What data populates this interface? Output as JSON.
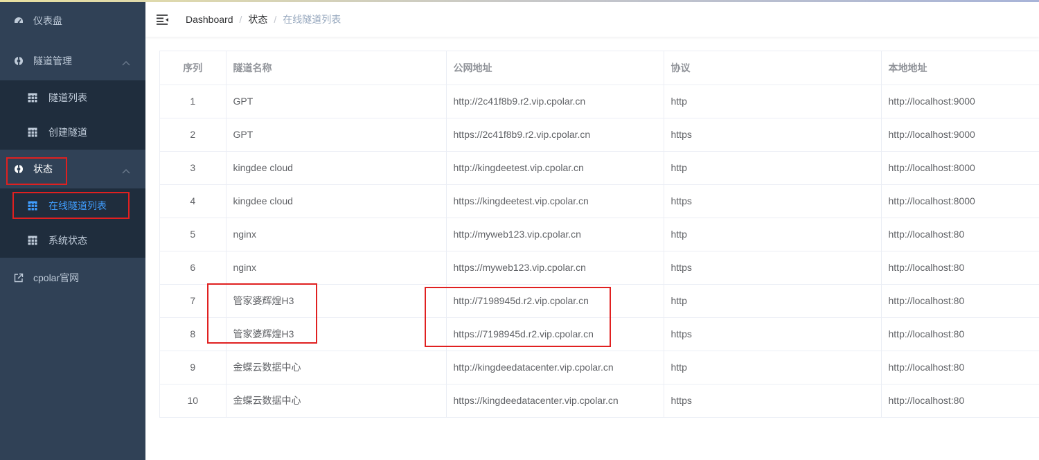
{
  "sidebar": {
    "dashboard": "仪表盘",
    "tunnel_mgmt": "隧道管理",
    "tunnel_list": "隧道列表",
    "create_tunnel": "创建隧道",
    "status": "状态",
    "online_tunnels": "在线隧道列表",
    "system_status": "系统状态",
    "website": "cpolar官网"
  },
  "breadcrumb": [
    "Dashboard",
    "状态",
    "在线隧道列表"
  ],
  "breadcrumb_sep": "/",
  "table": {
    "headers": [
      "序列",
      "隧道名称",
      "公网地址",
      "协议",
      "本地地址"
    ],
    "rows": [
      [
        "1",
        "GPT",
        "http://2c41f8b9.r2.vip.cpolar.cn",
        "http",
        "http://localhost:9000"
      ],
      [
        "2",
        "GPT",
        "https://2c41f8b9.r2.vip.cpolar.cn",
        "https",
        "http://localhost:9000"
      ],
      [
        "3",
        "kingdee cloud",
        "http://kingdeetest.vip.cpolar.cn",
        "http",
        "http://localhost:8000"
      ],
      [
        "4",
        "kingdee cloud",
        "https://kingdeetest.vip.cpolar.cn",
        "https",
        "http://localhost:8000"
      ],
      [
        "5",
        "nginx",
        "http://myweb123.vip.cpolar.cn",
        "http",
        "http://localhost:80"
      ],
      [
        "6",
        "nginx",
        "https://myweb123.vip.cpolar.cn",
        "https",
        "http://localhost:80"
      ],
      [
        "7",
        "管家婆辉煌H3",
        "http://7198945d.r2.vip.cpolar.cn",
        "http",
        "http://localhost:80"
      ],
      [
        "8",
        "管家婆辉煌H3",
        "https://7198945d.r2.vip.cpolar.cn",
        "https",
        "http://localhost:80"
      ],
      [
        "9",
        "金蝶云数据中心",
        "http://kingdeedatacenter.vip.cpolar.cn",
        "http",
        "http://localhost:80"
      ],
      [
        "10",
        "金蝶云数据中心",
        "https://kingdeedatacenter.vip.cpolar.cn",
        "https",
        "http://localhost:80"
      ]
    ]
  },
  "colors": {
    "sidebar_bg": "#304156",
    "submenu_bg": "#1f2d3d",
    "menu_text": "#bfcbd9",
    "active": "#409eff",
    "highlight_box": "#e02020"
  }
}
